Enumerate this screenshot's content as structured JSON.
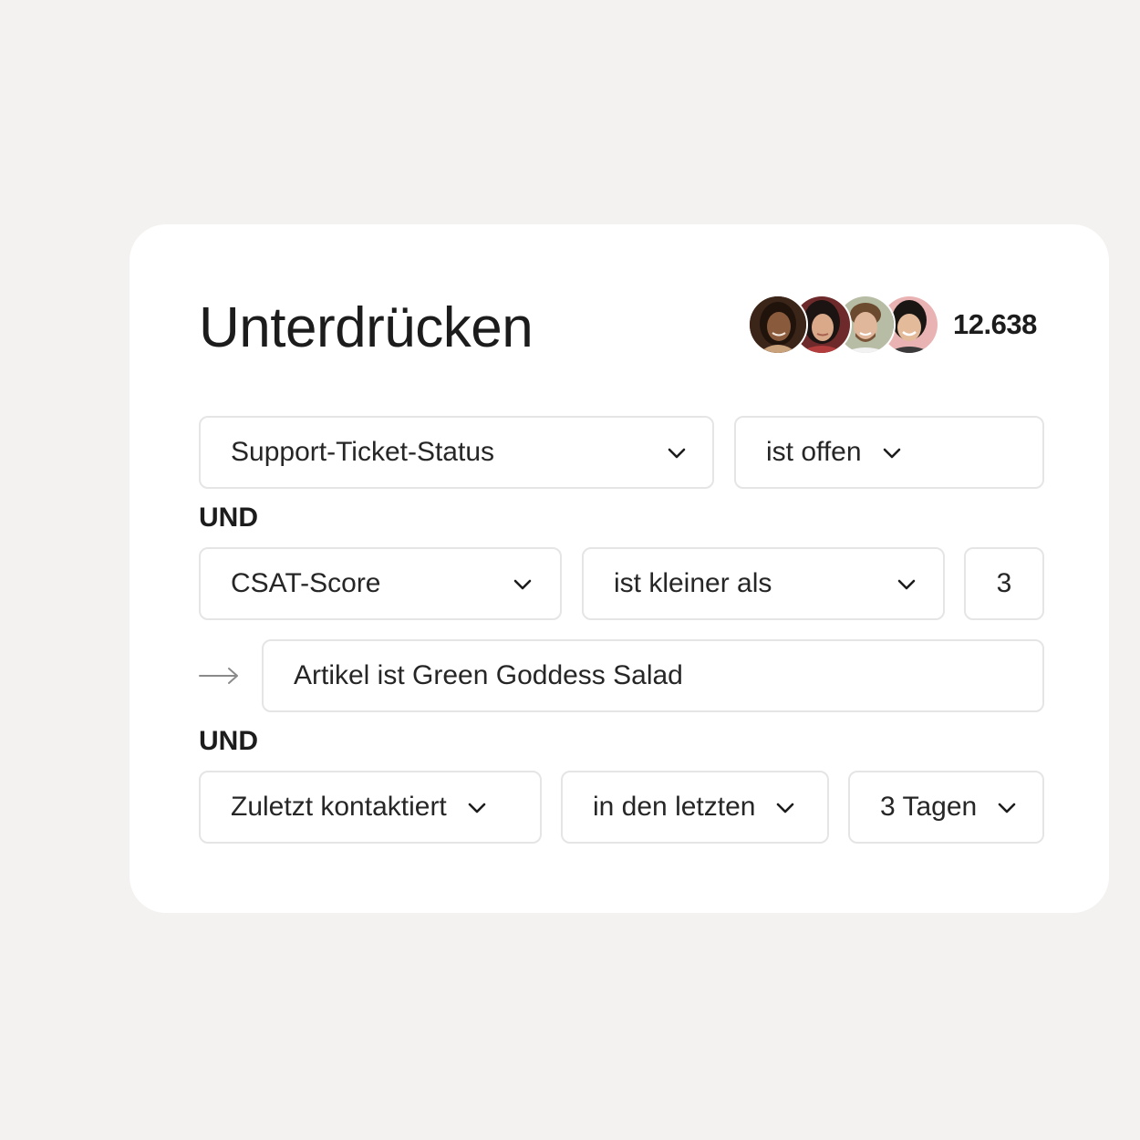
{
  "panel": {
    "title": "Unterdrücken",
    "audience": {
      "count": "12.638",
      "avatars": [
        "avatar-1",
        "avatar-2",
        "avatar-3",
        "avatar-4"
      ]
    }
  },
  "rules": {
    "row1": {
      "attribute": "Support-Ticket-Status",
      "operator": "ist offen"
    },
    "connector1": "UND",
    "row2": {
      "attribute": "CSAT-Score",
      "operator": "ist kleiner als",
      "value": "3"
    },
    "subcondition": {
      "text": "Artikel ist Green Goddess Salad"
    },
    "connector2": "UND",
    "row3": {
      "attribute": "Zuletzt kontaktiert",
      "operator": "in den letzten",
      "value": "3 Tagen"
    }
  },
  "icons": {
    "dropdown": "chevron-down-icon",
    "nested": "arrow-right-icon"
  },
  "colors": {
    "background": "#f3f2f0",
    "card": "#ffffff",
    "border": "#e5e5e5",
    "text": "#1c1c1c"
  }
}
